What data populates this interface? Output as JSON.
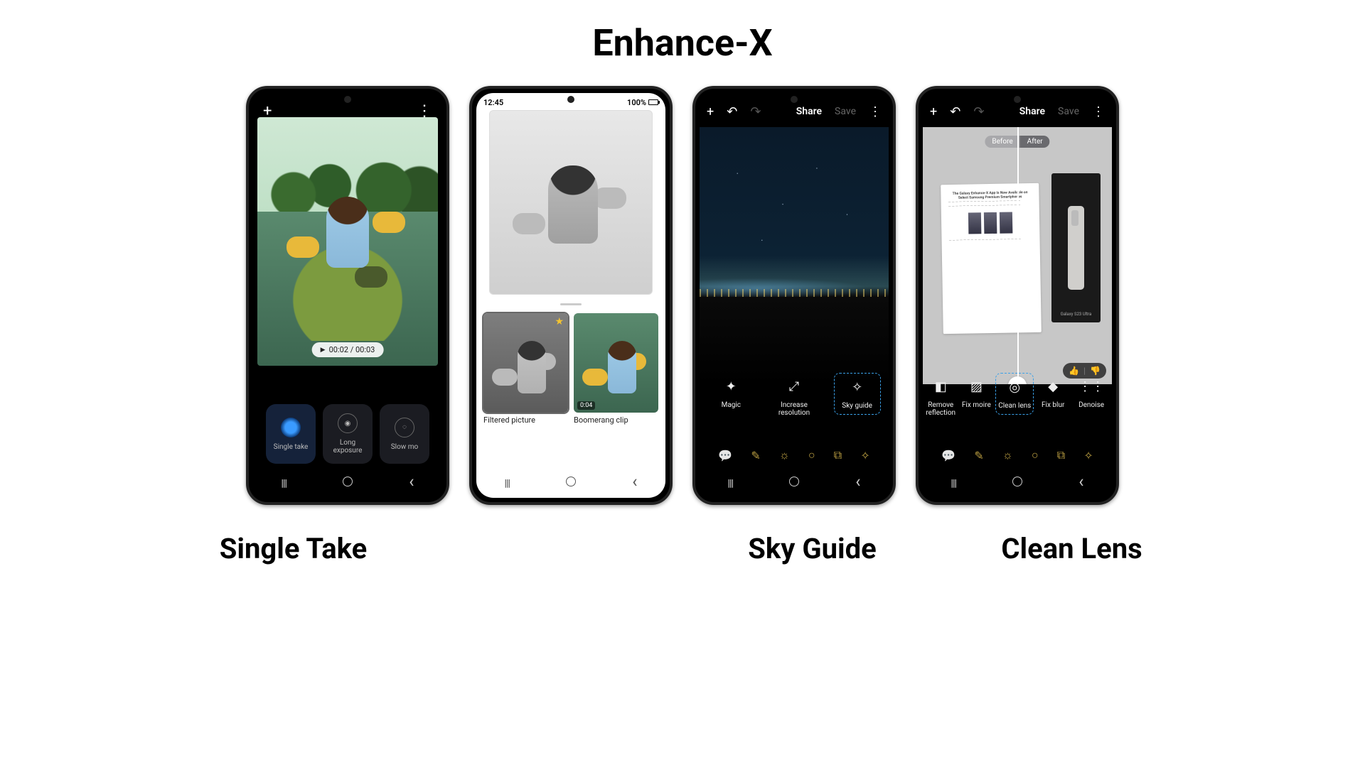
{
  "title": "Enhance-X",
  "labels": {
    "single_take": "Single Take",
    "sky_guide": "Sky Guide",
    "clean_lens": "Clean Lens"
  },
  "phone1": {
    "timecode": "00:02 / 00:03",
    "modes": [
      {
        "label": "Single take",
        "active": true
      },
      {
        "label": "Long exposure",
        "active": false
      },
      {
        "label": "Slow mo",
        "active": false
      }
    ]
  },
  "phone2": {
    "status_time": "12:45",
    "status_batt": "100%",
    "thumbs": [
      {
        "label": "Filtered picture",
        "selected": true
      },
      {
        "label": "Boomerang clip",
        "tag": "0:04"
      }
    ]
  },
  "editor": {
    "share": "Share",
    "save": "Save"
  },
  "phone3": {
    "tools": [
      {
        "icon": "✦",
        "label": "Magic"
      },
      {
        "icon": "⤢",
        "label": "Increase resolution"
      },
      {
        "icon": "✧",
        "label": "Sky guide",
        "highlight": true
      }
    ]
  },
  "phone4": {
    "before": "Before",
    "after": "After",
    "box_label": "Galaxy S23 Ultra",
    "paper_title": "The Galaxy Enhance-X App Is Now Available on Select Samsung Premium Smartphones",
    "tools": [
      {
        "icon": "◧",
        "label": "Remove reflection"
      },
      {
        "icon": "▨",
        "label": "Fix moire"
      },
      {
        "icon": "◎",
        "label": "Clean lens",
        "highlight": true
      },
      {
        "icon": "◆",
        "label": "Fix blur"
      },
      {
        "icon": "⋮⋮",
        "label": "Denoise"
      }
    ]
  },
  "bottom_icons": [
    "💬",
    "✎",
    "☼",
    "○",
    "⧉",
    "✧"
  ]
}
